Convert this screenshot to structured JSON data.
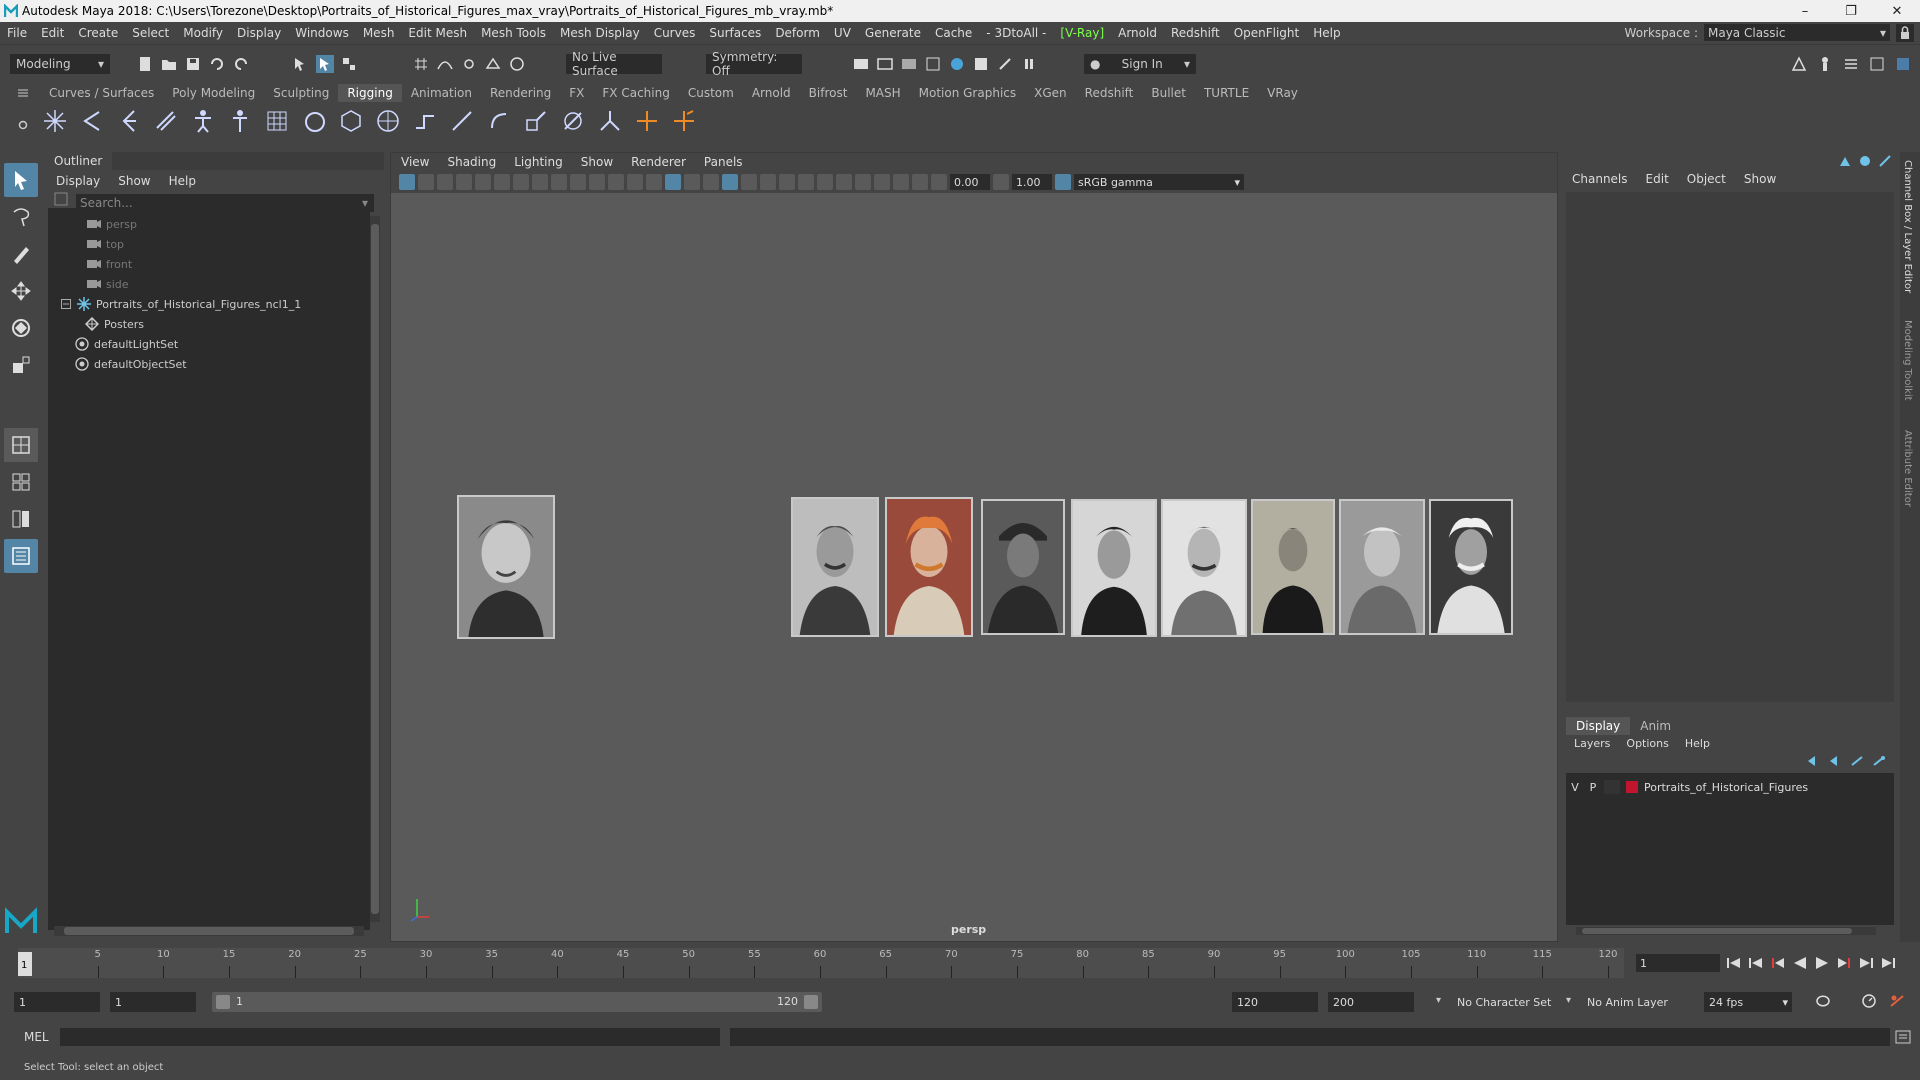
{
  "app": {
    "title": "Autodesk Maya 2018: C:\\Users\\Torezone\\Desktop\\Portraits_of_Historical_Figures_max_vray\\Portraits_of_Historical_Figures_mb_vray.mb*",
    "window_buttons": [
      "–",
      "❐",
      "✕"
    ]
  },
  "menubar": {
    "items": [
      "File",
      "Edit",
      "Create",
      "Select",
      "Modify",
      "Display",
      "Windows",
      "Mesh",
      "Edit Mesh",
      "Mesh Tools",
      "Mesh Display",
      "Curves",
      "Surfaces",
      "Deform",
      "UV",
      "Generate",
      "Cache",
      "- 3DtoAll -"
    ],
    "vray": "[V-Ray]",
    "items_after": [
      "Arnold",
      "Redshift",
      "OpenFlight",
      "Help"
    ],
    "workspace_label": "Workspace :",
    "workspace_value": "Maya Classic"
  },
  "statusline": {
    "mode": "Modeling",
    "live_surface": "No Live Surface",
    "symmetry": "Symmetry: Off",
    "sign_in": "Sign In"
  },
  "shelf": {
    "tabs": [
      "Curves / Surfaces",
      "Poly Modeling",
      "Sculpting",
      "Rigging",
      "Animation",
      "Rendering",
      "FX",
      "FX Caching",
      "Custom",
      "Arnold",
      "Bifrost",
      "MASH",
      "Motion Graphics",
      "XGen",
      "Redshift",
      "Bullet",
      "TURTLE",
      "VRay"
    ],
    "active_tab": "Rigging"
  },
  "outliner": {
    "title": "Outliner",
    "menu": [
      "Display",
      "Show",
      "Help"
    ],
    "search_placeholder": "Search...",
    "items": [
      {
        "label": "persp",
        "type": "camera",
        "indent": 0,
        "dim": true
      },
      {
        "label": "top",
        "type": "camera",
        "indent": 0,
        "dim": true
      },
      {
        "label": "front",
        "type": "camera",
        "indent": 0,
        "dim": true
      },
      {
        "label": "side",
        "type": "camera",
        "indent": 0,
        "dim": true
      },
      {
        "label": "Portraits_of_Historical_Figures_ncl1_1",
        "type": "group",
        "indent": 0,
        "dim": false
      },
      {
        "label": "Posters",
        "type": "mesh",
        "indent": 1,
        "dim": false
      },
      {
        "label": "defaultLightSet",
        "type": "set",
        "indent": 0,
        "dim": false
      },
      {
        "label": "defaultObjectSet",
        "type": "set",
        "indent": 0,
        "dim": false
      }
    ]
  },
  "viewport": {
    "menu": [
      "View",
      "Shading",
      "Lighting",
      "Show",
      "Renderer",
      "Panels"
    ],
    "exposure": "0.00",
    "gamma_value": "1.00",
    "color_space": "sRGB gamma",
    "camera": "persp"
  },
  "channelbox": {
    "menu": [
      "Channels",
      "Edit",
      "Object",
      "Show"
    ],
    "side_tabs": [
      "Channel Box / Layer Editor",
      "Modeling Toolkit",
      "Attribute Editor"
    ]
  },
  "layers": {
    "tabs": [
      "Display",
      "Anim"
    ],
    "active_tab": "Display",
    "menu": [
      "Layers",
      "Options",
      "Help"
    ],
    "rows": [
      {
        "v": "V",
        "p": "P",
        "name": "Portraits_of_Historical_Figures",
        "color": "#c0152f"
      }
    ]
  },
  "timeline": {
    "ticks": [
      "5",
      "10",
      "15",
      "20",
      "25",
      "30",
      "35",
      "40",
      "45",
      "50",
      "55",
      "60",
      "65",
      "70",
      "75",
      "80",
      "85",
      "90",
      "95",
      "100",
      "105",
      "110",
      "115",
      "120"
    ],
    "current_marker": "1",
    "current_frame": "1"
  },
  "range": {
    "start": "1",
    "playback_start": "1",
    "slider_start": "1",
    "slider_end": "120",
    "playback_end": "120",
    "end": "200",
    "character_set": "No Character Set",
    "anim_layer": "No Anim Layer",
    "fps": "24 fps"
  },
  "cmdline": {
    "label": "MEL"
  },
  "helpline": {
    "text": "Select Tool: select an object"
  },
  "colors": {
    "accent": "#5285a6",
    "vray_green": "#7cff4a",
    "layer_red": "#c0152f",
    "viewport_bg": "#5a5a5a"
  }
}
